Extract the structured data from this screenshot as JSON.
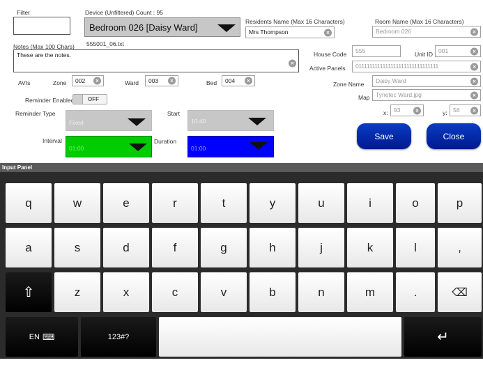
{
  "filter": {
    "label": "Filter",
    "value": ""
  },
  "device": {
    "label": "Device (Unfiltered) Count : 95",
    "value": "Bedroom 026 [Daisy Ward]",
    "file": "555001_06.txt"
  },
  "residents": {
    "label": "Residents Name (Max 16 Characters)",
    "value": "Mrs Thompson"
  },
  "room": {
    "label": "Room Name (Max 16 Characters)",
    "value": "Bedroom 026"
  },
  "notes": {
    "label": "Notes (Max 100 Chars)",
    "value": "These are the notes."
  },
  "house_code": {
    "label": "House Code",
    "value": "555"
  },
  "unit_id": {
    "label": "Unit ID",
    "value": "001"
  },
  "active_panels": {
    "label": "Active Panels",
    "value": "0111111111111111111111111111111"
  },
  "avis": {
    "label": "AVIs",
    "zone_label": "Zone",
    "zone_value": "002",
    "ward_label": "Ward",
    "ward_value": "003",
    "bed_label": "Bed",
    "bed_value": "004"
  },
  "zone_name": {
    "label": "Zone Name",
    "value": "Daisy Ward"
  },
  "map": {
    "label": "Map",
    "value": "Tynetec Ward.jpg"
  },
  "coords": {
    "x_label": "x:",
    "x_value": "93",
    "y_label": "y:",
    "y_value": "58"
  },
  "reminder": {
    "enabled_label": "Reminder Enabled",
    "toggle_state": "OFF",
    "type_label": "Reminder Type",
    "type_value": "Fixed",
    "start_label": "Start",
    "start_value": "10:40",
    "interval_label": "Interval",
    "interval_value": "01:00",
    "duration_label": "Duration",
    "duration_value": "01:00"
  },
  "buttons": {
    "save": "Save",
    "close": "Close"
  },
  "keyboard": {
    "title": "Input Panel",
    "row1": [
      "q",
      "w",
      "e",
      "r",
      "t",
      "y",
      "u",
      "i",
      "o",
      "p"
    ],
    "row2": [
      "a",
      "s",
      "d",
      "f",
      "g",
      "h",
      "j",
      "k",
      "l",
      ","
    ],
    "row3": [
      "z",
      "x",
      "c",
      "v",
      "b",
      "n",
      "m",
      "."
    ],
    "lang": "EN",
    "numsym": "123#?"
  },
  "colors": {
    "interval_bg": "#00cc00",
    "duration_bg": "#0000ff",
    "accent": "#0a2fb5"
  }
}
